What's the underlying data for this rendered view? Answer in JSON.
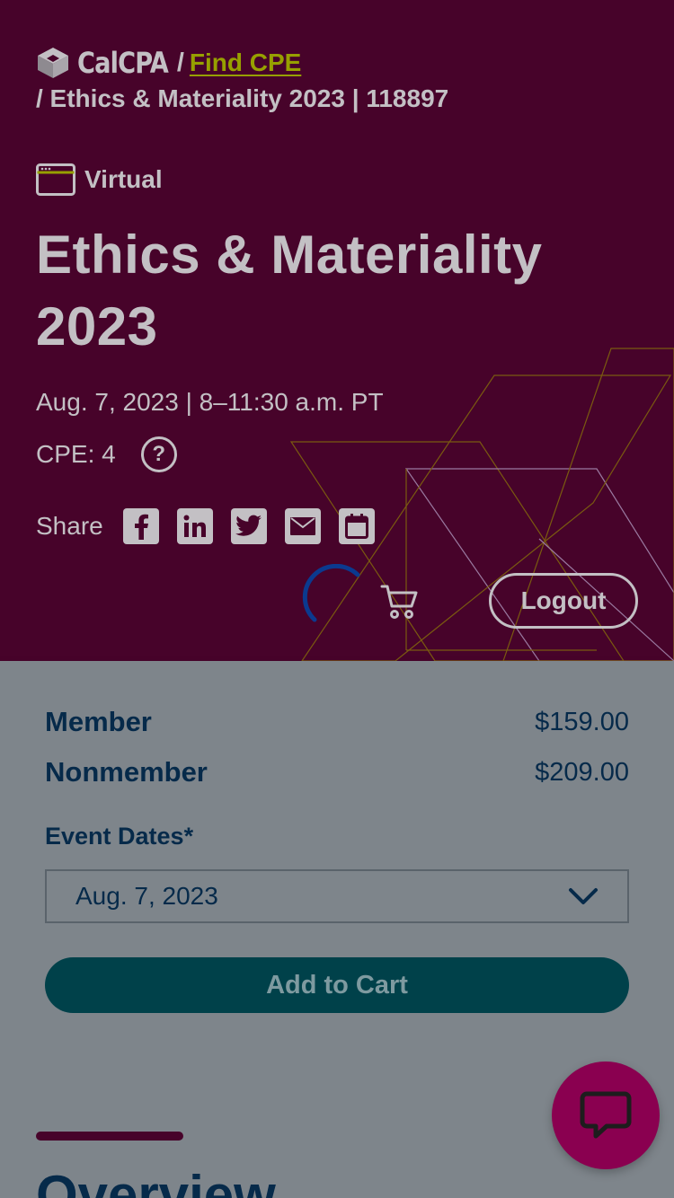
{
  "breadcrumb": {
    "logo_text": "CalCPA",
    "separator": "/",
    "link_label": "Find CPE",
    "current": "/ Ethics & Materiality 2023 | 118897"
  },
  "event": {
    "format": "Virtual",
    "title": "Ethics & Materiality 2023",
    "date_time": "Aug. 7, 2023 | 8–11:30 a.m. PT",
    "cpe": "CPE: 4",
    "help_glyph": "?"
  },
  "share": {
    "label": "Share",
    "icons": [
      "facebook-icon",
      "linkedin-icon",
      "twitter-icon",
      "email-icon",
      "calendar-icon"
    ]
  },
  "header_actions": {
    "logout_label": "Logout"
  },
  "pricing": {
    "member_label": "Member",
    "member_price": "$159.00",
    "nonmember_label": "Nonmember",
    "nonmember_price": "$209.00"
  },
  "event_dates": {
    "label": "Event Dates*",
    "selected": "Aug. 7, 2023"
  },
  "cart": {
    "add_label": "Add to Cart"
  },
  "section": {
    "heading": "Overview"
  },
  "colors": {
    "hero_bg": "#47032a",
    "panel_bg": "#7e858b",
    "navy": "#062a4a",
    "teal_button": "#00414a",
    "chat_button": "#8a0050",
    "link": "#97a000"
  }
}
